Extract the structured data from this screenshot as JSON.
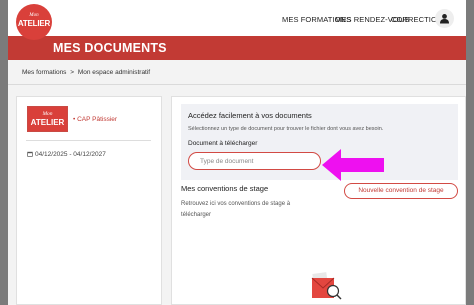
{
  "logo": {
    "small": "Mon",
    "big": "ATELIER"
  },
  "nav": {
    "items": [
      "MES FORMATIONS",
      "MES RENDEZ-VOUS",
      "CORRECTION"
    ]
  },
  "header": {
    "title": "MES DOCUMENTS"
  },
  "breadcrumb": {
    "items": [
      "Mes formations",
      ">",
      "Mon espace administratif"
    ]
  },
  "course": {
    "badge_small": "Mon",
    "badge_big": "ATELIER",
    "name": "• CAP Pâtissier",
    "dates": "04/12/2025 - 04/12/2027"
  },
  "documents": {
    "title": "Accédez facilement à vos documents",
    "description": "Sélectionnez un type de document pour trouver le fichier dont vous avez besoin.",
    "field_label": "Document à télécharger",
    "select_placeholder": "Type de document"
  },
  "conventions": {
    "title": "Mes conventions de stage",
    "description": "Retrouvez ici vos conventions de stage à télécharger",
    "button_label": "Nouvelle convention de stage"
  },
  "colors": {
    "brand_red": "#c23a34",
    "arrow_magenta": "#ee10f0"
  }
}
